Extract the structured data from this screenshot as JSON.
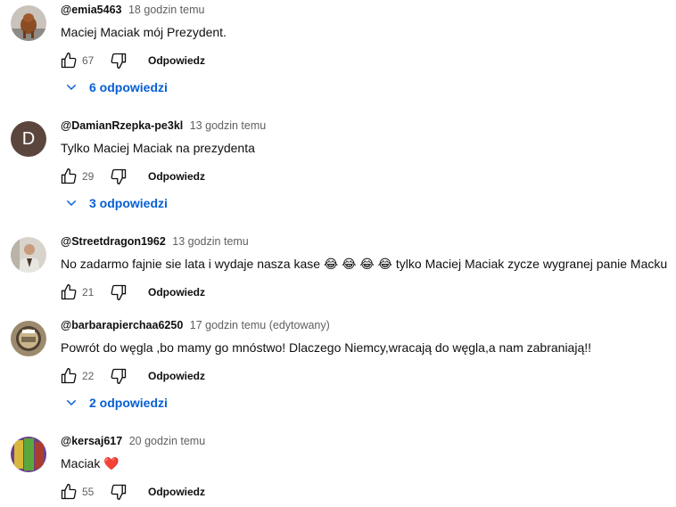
{
  "comments": [
    {
      "author": "@emia5463",
      "time": "18 godzin temu",
      "text": "Maciej Maciak mój Prezydent.",
      "likes": "67",
      "reply_label": "Odpowiedz",
      "replies_label": "6 odpowiedzi",
      "avatar_icon": "dog-photo-icon"
    },
    {
      "author": "@DamianRzepka-pe3kl",
      "time": "13 godzin temu",
      "text": "Tylko Maciej Maciak na prezydenta",
      "likes": "29",
      "reply_label": "Odpowiedz",
      "replies_label": "3 odpowiedzi",
      "avatar_letter": "D",
      "avatar_color": "#5b463d"
    },
    {
      "author": "@Streetdragon1962",
      "time": "13 godzin temu",
      "text": "No zadarmo fajnie sie lata i wydaje nasza kase 😂 😂 😂 😂 tylko Maciej Maciak zycze wygranej panie Macku",
      "likes": "21",
      "reply_label": "Odpowiedz",
      "avatar_icon": "person-photo-icon"
    },
    {
      "author": "@barbarapierchaa6250",
      "time": "17 godzin temu (edytowany)",
      "text": "Powrót do węgla  ,bo mamy go mnóstwo! Dlaczego Niemcy,wracają do węgla,a nam zabraniają!!",
      "likes": "22",
      "reply_label": "Odpowiedz",
      "replies_label": "2 odpowiedzi",
      "avatar_icon": "badge-photo-icon"
    },
    {
      "author": "@kersaj617",
      "time": "20 godzin temu",
      "text": "Maciak ❤️",
      "likes": "55",
      "reply_label": "Odpowiedz",
      "avatar_icon": "snacks-photo-icon"
    }
  ],
  "colors": {
    "link_blue": "#065fd4",
    "secondary_text": "#606060"
  }
}
